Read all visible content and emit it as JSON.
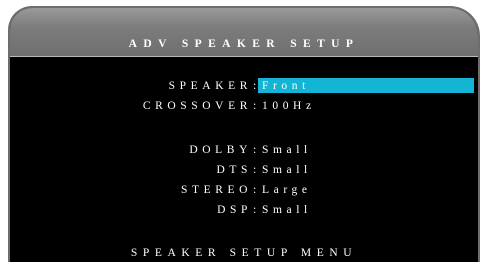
{
  "title": "ADV SPEAKER SETUP",
  "separator": ":",
  "rows": [
    {
      "label": "SPEAKER",
      "value": "Front",
      "selected": true
    },
    {
      "label": "CROSSOVER",
      "value": "100Hz",
      "selected": false
    },
    {
      "label": "DOLBY",
      "value": "Small",
      "selected": false
    },
    {
      "label": "DTS",
      "value": "Small",
      "selected": false
    },
    {
      "label": "STEREO",
      "value": "Large",
      "selected": false
    },
    {
      "label": "DSP",
      "value": "Small",
      "selected": false
    }
  ],
  "footer": "SPEAKER SETUP MENU",
  "colors": {
    "background": "#000000",
    "highlight": "#14b4d4",
    "title_bar": "#7c7c7c",
    "text": "#ffffff"
  }
}
